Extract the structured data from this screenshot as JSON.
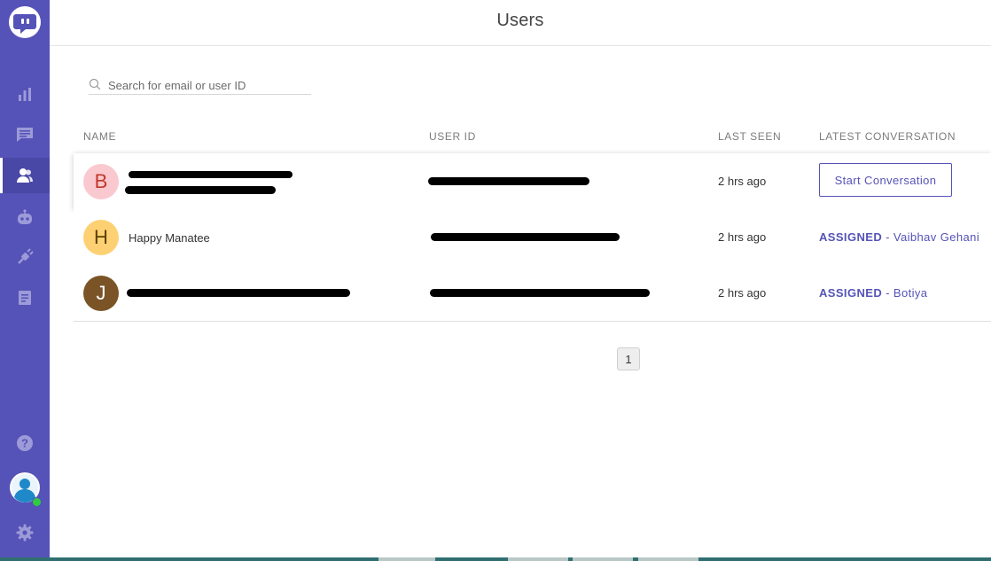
{
  "app": {
    "page_title": "Users"
  },
  "sidebar": {
    "items": [
      {
        "icon": "bar-chart-icon"
      },
      {
        "icon": "conversations-icon"
      },
      {
        "icon": "users-icon",
        "active": true
      },
      {
        "icon": "bot-icon"
      },
      {
        "icon": "integrations-icon"
      },
      {
        "icon": "reports-icon"
      }
    ],
    "bottom": [
      {
        "icon": "help-icon"
      },
      {
        "icon": "profile-avatar-icon",
        "status": "online"
      },
      {
        "icon": "gear-icon"
      }
    ],
    "colors": {
      "background": "#5553b7",
      "online": "#2ecc40"
    }
  },
  "search": {
    "placeholder": "Search for email or user ID",
    "value": ""
  },
  "table": {
    "headers": {
      "name": "NAME",
      "user_id": "USER ID",
      "last_seen": "LAST SEEN",
      "latest_conversation": "LATEST CONVERSATION"
    },
    "rows": [
      {
        "initial": "B",
        "avatar_color": "#f9c9cf",
        "initial_color": "#c0392b",
        "name": "",
        "name_redacted": true,
        "user_id": "",
        "user_id_redacted": true,
        "last_seen": "2 hrs ago",
        "conversation": {
          "type": "button",
          "label": "Start Conversation"
        }
      },
      {
        "initial": "H",
        "avatar_color": "#fdd173",
        "initial_color": "#5a4100",
        "name": "Happy Manatee",
        "name_redacted": false,
        "user_id": "",
        "user_id_redacted": true,
        "last_seen": "2 hrs ago",
        "conversation": {
          "type": "assigned",
          "status": "ASSIGNED",
          "agent": "Vaibhav Gehani"
        }
      },
      {
        "initial": "J",
        "avatar_color": "#7a5426",
        "initial_color": "#ffffff",
        "name": "",
        "name_redacted": true,
        "user_id": "",
        "user_id_redacted": true,
        "last_seen": "2 hrs ago",
        "conversation": {
          "type": "assigned",
          "status": "ASSIGNED",
          "agent": "Botiya"
        }
      }
    ]
  },
  "pagination": {
    "current_page": "1"
  },
  "colors": {
    "accent": "#5553b7"
  }
}
